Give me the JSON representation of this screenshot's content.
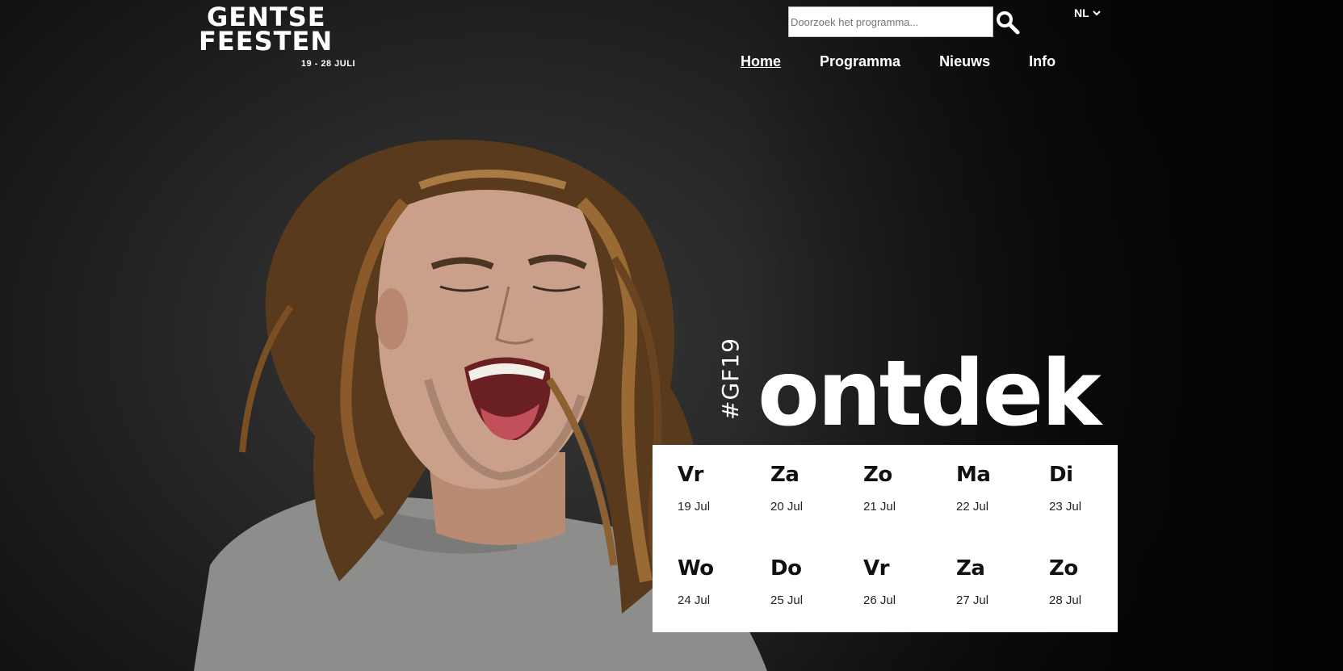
{
  "logo": {
    "line1": "GENTSE",
    "line2": "FEESTEN",
    "dates": "19 - 28 JULI"
  },
  "search": {
    "placeholder": "Doorzoek het programma..."
  },
  "language": {
    "selected": "NL"
  },
  "nav": {
    "items": [
      "Home",
      "Programma",
      "Nieuws",
      "Info"
    ],
    "active": "Home"
  },
  "hero": {
    "hashtag": "#GF19",
    "headline": "ontdek"
  },
  "calendar": {
    "days": [
      {
        "name": "Vr",
        "date": "19 Jul"
      },
      {
        "name": "Za",
        "date": "20 Jul"
      },
      {
        "name": "Zo",
        "date": "21 Jul"
      },
      {
        "name": "Ma",
        "date": "22 Jul"
      },
      {
        "name": "Di",
        "date": "23 Jul"
      },
      {
        "name": "Wo",
        "date": "24 Jul"
      },
      {
        "name": "Do",
        "date": "25 Jul"
      },
      {
        "name": "Vr",
        "date": "26 Jul"
      },
      {
        "name": "Za",
        "date": "27 Jul"
      },
      {
        "name": "Zo",
        "date": "28 Jul"
      }
    ]
  },
  "colors": {
    "background": "#1b1b1b",
    "text": "#ffffff",
    "calendar_bg": "#ffffff"
  }
}
